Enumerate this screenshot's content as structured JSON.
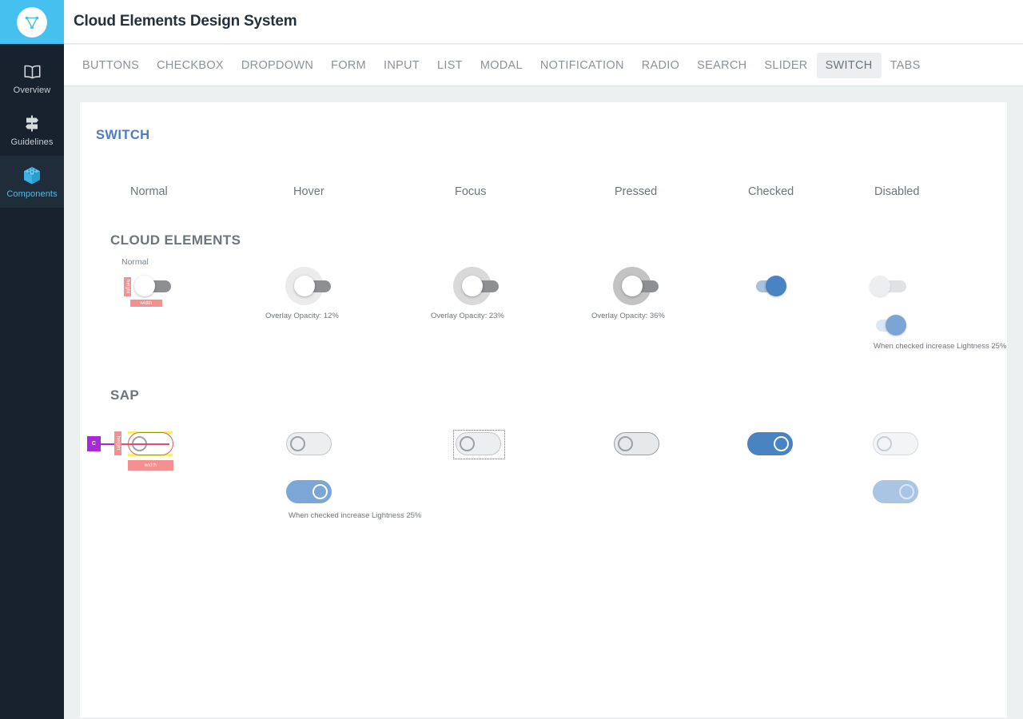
{
  "app": {
    "title": "Cloud Elements Design System",
    "logo_icon": "cloud-elements-logo"
  },
  "sidebar": {
    "items": [
      {
        "label": "Overview",
        "icon": "book-icon",
        "active": false
      },
      {
        "label": "Guidelines",
        "icon": "signpost-icon",
        "active": false
      },
      {
        "label": "Components",
        "icon": "cube-icon",
        "active": true
      }
    ]
  },
  "tabs": [
    {
      "label": "BUTTONS",
      "active": false
    },
    {
      "label": "CHECKBOX",
      "active": false
    },
    {
      "label": "DROPDOWN",
      "active": false
    },
    {
      "label": "FORM",
      "active": false
    },
    {
      "label": "INPUT",
      "active": false
    },
    {
      "label": "LIST",
      "active": false
    },
    {
      "label": "MODAL",
      "active": false
    },
    {
      "label": "NOTIFICATION",
      "active": false
    },
    {
      "label": "RADIO",
      "active": false
    },
    {
      "label": "SEARCH",
      "active": false
    },
    {
      "label": "SLIDER",
      "active": false
    },
    {
      "label": "SWITCH",
      "active": true
    },
    {
      "label": "TABS",
      "active": false
    }
  ],
  "page": {
    "title": "SWITCH",
    "title_color": "#4b7ec0"
  },
  "states": {
    "normal": "Normal",
    "hover": "Hover",
    "focus": "Focus",
    "pressed": "Pressed",
    "checked": "Checked",
    "disabled": "Disabled"
  },
  "sections": {
    "cloud_elements": {
      "label": "CLOUD ELEMENTS",
      "normal_sub_label": "Normal",
      "annotations": {
        "height": "height",
        "width": "width"
      },
      "captions": {
        "hover": "Overlay Opacity: 12%",
        "focus": "Overlay Opacity: 23%",
        "pressed": "Overlay Opacity: 36%",
        "disabled_checked": "When checked increase Lightness 25%"
      }
    },
    "sap": {
      "label": "SAP",
      "annotations": {
        "corner": "C",
        "height": "height",
        "width": "width"
      },
      "captions": {
        "hover_checked": "When checked increase Lightness 25%"
      }
    }
  },
  "colors": {
    "brand_cyan": "#45c0ef",
    "accent_blue": "#4a83c2",
    "accent_blue_light": "#7ba6d6",
    "sidebar_bg": "#18222e",
    "page_bg": "#edf0f1",
    "annotation_red": "#f4908f",
    "annotation_purple": "#a62bd6",
    "annotation_yellow": "#f7f360"
  }
}
